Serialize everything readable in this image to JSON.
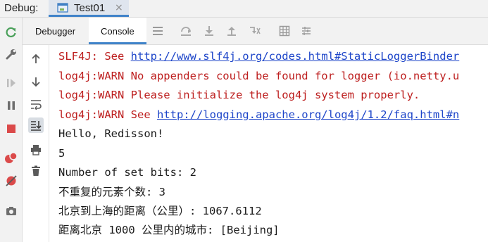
{
  "titlebar": {
    "debug_label": "Debug:",
    "tab_label": "Test01",
    "tab_close": "×"
  },
  "tabs": [
    {
      "label": "Debugger"
    },
    {
      "label": "Console"
    }
  ],
  "console": {
    "lines": [
      {
        "kind": "err",
        "prefix": "SLF4J: See ",
        "link": "http://www.slf4j.org/codes.html#StaticLoggerBinder"
      },
      {
        "kind": "err",
        "text": "log4j:WARN No appenders could be found for logger (io.netty.u"
      },
      {
        "kind": "err",
        "text": "log4j:WARN Please initialize the log4j system properly."
      },
      {
        "kind": "err",
        "prefix": "log4j:WARN See ",
        "link": "http://logging.apache.org/log4j/1.2/faq.html#n"
      },
      {
        "kind": "out",
        "text": "Hello, Redisson!"
      },
      {
        "kind": "out",
        "text": "5"
      },
      {
        "kind": "out",
        "text": "Number of set bits: 2"
      },
      {
        "kind": "out",
        "text": "不重复的元素个数: 3"
      },
      {
        "kind": "out",
        "text": "北京到上海的距离（公里）: 1067.6112"
      },
      {
        "kind": "out",
        "text": "距离北京 1000 公里内的城市: [Beijing]"
      }
    ]
  },
  "colors": {
    "error_text": "#bd1e1e",
    "link": "#1d45c9",
    "normal_text": "#1b1b1b",
    "accent": "#4083c9"
  },
  "icons": {
    "left_toolbar": [
      "rerun-icon",
      "settings-wrench-icon",
      "resume-icon",
      "pause-icon",
      "stop-icon",
      "view-breakpoints-icon",
      "mute-breakpoints-icon",
      "camera-icon"
    ],
    "tab_toolbar": [
      "layout-icon",
      "step-over-icon",
      "step-into-icon",
      "step-out-icon",
      "run-to-cursor-icon",
      "evaluate-icon",
      "trace-icon"
    ],
    "console_toolbar": [
      "up-arrow-icon",
      "down-arrow-icon",
      "soft-wrap-icon",
      "scroll-to-end-icon",
      "print-icon",
      "clear-all-icon"
    ]
  }
}
